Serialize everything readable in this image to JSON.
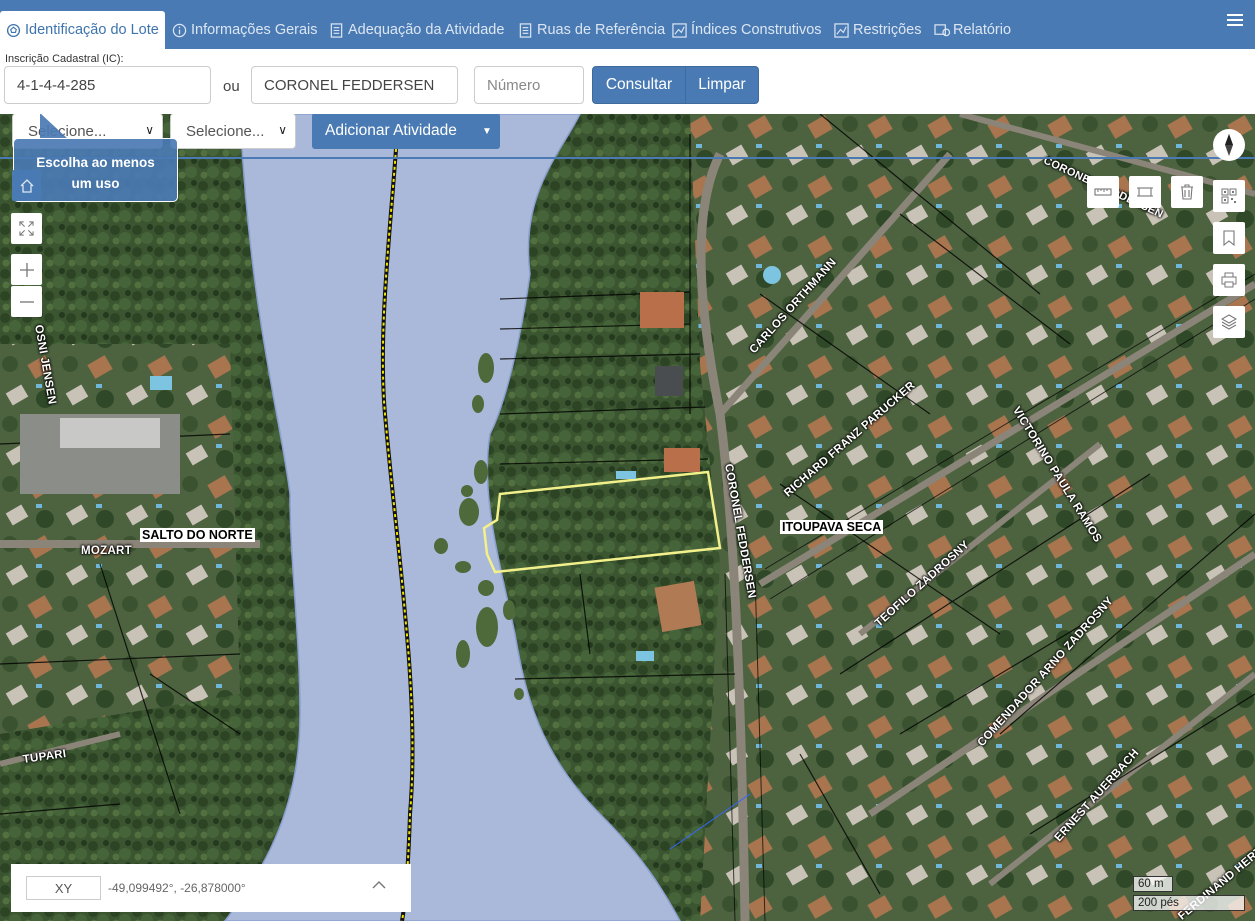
{
  "tabs": [
    {
      "label": "Identificação do Lote",
      "icon": "lot-pin-icon",
      "active": true
    },
    {
      "label": "Informações Gerais",
      "icon": "info-icon"
    },
    {
      "label": "Adequação da Atividade",
      "icon": "document-icon"
    },
    {
      "label": "Ruas de Referência",
      "icon": "document-icon"
    },
    {
      "label": "Índices Construtivos",
      "icon": "chart-icon"
    },
    {
      "label": "Restrições",
      "icon": "chart-icon"
    },
    {
      "label": "Relatório",
      "icon": "report-icon"
    }
  ],
  "search": {
    "ic_label": "Inscrição Cadastral (IC):",
    "ic_value": "4-1-4-4-285",
    "ou": "ou",
    "street_value": "CORONEL FEDDERSEN",
    "number_placeholder": "Número",
    "consult_label": "Consultar",
    "clear_label": "Limpar"
  },
  "activity": {
    "select1": "Selecione...",
    "select2": "Selecione...",
    "add_label": "Adicionar Atividade",
    "tooltip_line1": "Escolha ao menos",
    "tooltip_line2": "um uso"
  },
  "map": {
    "streets": [
      "OSNI JENSEN",
      "CORONEL FEDDERSEN",
      "CARLOS ORTHMANN",
      "RICHARD FRANZ PARUCKER",
      "VICTORINO PAULA RAMOS",
      "CORONEL FEDDERSEN",
      "TEOFILO ZADROSNY",
      "COMENDADOR ARNO ZADROSNY",
      "ERNEST AUERBACH",
      "MOZART",
      "TUPARI",
      "FERDINAND HERTEL",
      "CORONEL FEDDERSEN"
    ],
    "districts": [
      "SALTO DO NORTE",
      "ITOUPAVA SECA"
    ],
    "coord_mode": "XY",
    "coordinates": "-49,099492°, -26,878000°",
    "scale_m": "60 m",
    "scale_ft": "200 pés",
    "colors": {
      "accent": "#4a7ab3",
      "river": "#a9b8d8",
      "lot_outline": "#f2f08a"
    }
  }
}
